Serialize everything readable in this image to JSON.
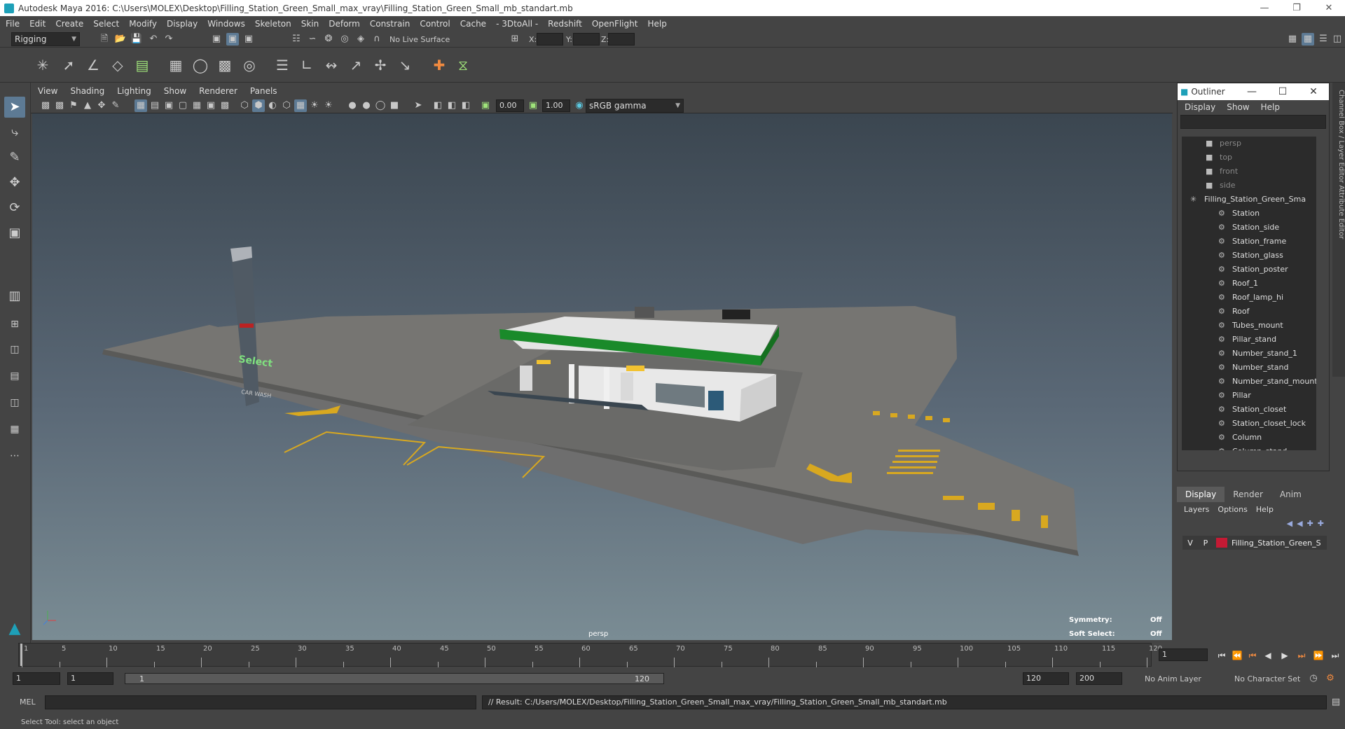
{
  "window": {
    "title": "Autodesk Maya 2016: C:\\Users\\MOLEX\\Desktop\\Filling_Station_Green_Small_max_vray\\Filling_Station_Green_Small_mb_standart.mb"
  },
  "menubar": [
    "File",
    "Edit",
    "Create",
    "Select",
    "Modify",
    "Display",
    "Windows",
    "Skeleton",
    "Skin",
    "Deform",
    "Constrain",
    "Control",
    "Cache",
    "- 3DtoAll -",
    "Redshift",
    "OpenFlight",
    "Help"
  ],
  "statusline": {
    "mode": "Rigging",
    "live_surface": "No Live Surface",
    "x_label": "X:",
    "y_label": "Y:",
    "z_label": "Z:"
  },
  "panel_menu": [
    "View",
    "Shading",
    "Lighting",
    "Show",
    "Renderer",
    "Panels"
  ],
  "panel_toolbar": {
    "exposure": "0.00",
    "gamma": "1.00",
    "color_space": "sRGB gamma"
  },
  "viewport": {
    "camera": "persp",
    "symmetry_label": "Symmetry:",
    "symmetry_value": "Off",
    "soft_select_label": "Soft Select:",
    "soft_select_value": "Off",
    "pylon_text": "Select",
    "pylon_text2": "CAR WASH"
  },
  "outliner": {
    "title": "Outliner",
    "menu": [
      "Display",
      "Show",
      "Help"
    ],
    "items": [
      {
        "label": "persp",
        "type": "camera"
      },
      {
        "label": "top",
        "type": "camera"
      },
      {
        "label": "front",
        "type": "camera"
      },
      {
        "label": "side",
        "type": "camera"
      },
      {
        "label": "Filling_Station_Green_Sma",
        "type": "group"
      },
      {
        "label": "Station",
        "type": "mesh"
      },
      {
        "label": "Station_side",
        "type": "mesh"
      },
      {
        "label": "Station_frame",
        "type": "mesh"
      },
      {
        "label": "Station_glass",
        "type": "mesh"
      },
      {
        "label": "Station_poster",
        "type": "mesh"
      },
      {
        "label": "Roof_1",
        "type": "mesh"
      },
      {
        "label": "Roof_lamp_hi",
        "type": "mesh"
      },
      {
        "label": "Roof",
        "type": "mesh"
      },
      {
        "label": "Tubes_mount",
        "type": "mesh"
      },
      {
        "label": "Pillar_stand",
        "type": "mesh"
      },
      {
        "label": "Number_stand_1",
        "type": "mesh"
      },
      {
        "label": "Number_stand",
        "type": "mesh"
      },
      {
        "label": "Number_stand_mount",
        "type": "mesh"
      },
      {
        "label": "Pillar",
        "type": "mesh"
      },
      {
        "label": "Station_closet",
        "type": "mesh"
      },
      {
        "label": "Station_closet_lock",
        "type": "mesh"
      },
      {
        "label": "Column",
        "type": "mesh"
      },
      {
        "label": "Column_stand",
        "type": "mesh"
      }
    ]
  },
  "layer_editor": {
    "tabs": [
      "Display",
      "Render",
      "Anim"
    ],
    "menu": [
      "Layers",
      "Options",
      "Help"
    ],
    "layer": {
      "v": "V",
      "p": "P",
      "name": "Filling_Station_Green_S",
      "color": "#c41a34"
    }
  },
  "side_tabs": "Channel Box / Layer Editor   Attribute Editor",
  "timeline": {
    "ticks": [
      1,
      5,
      10,
      15,
      20,
      25,
      30,
      35,
      40,
      45,
      50,
      55,
      60,
      65,
      70,
      75,
      80,
      85,
      90,
      95,
      100,
      105,
      110,
      115,
      120
    ],
    "current_frame": "1"
  },
  "range": {
    "start": "1",
    "start2": "1",
    "slider_start": "1",
    "slider_end": "120",
    "end": "120",
    "end2": "200",
    "anim_layer": "No Anim Layer",
    "character_set": "No Character Set"
  },
  "cmdline": {
    "lang": "MEL",
    "result": "// Result: C:/Users/MOLEX/Desktop/Filling_Station_Green_Small_max_vray/Filling_Station_Green_Small_mb_standart.mb"
  },
  "helpline": "Select Tool: select an object",
  "colors": {
    "accent": "#5d7a94",
    "roof_green": "#1a8a2a",
    "layer_red": "#c41a34",
    "lane_yellow": "#d8a820"
  }
}
